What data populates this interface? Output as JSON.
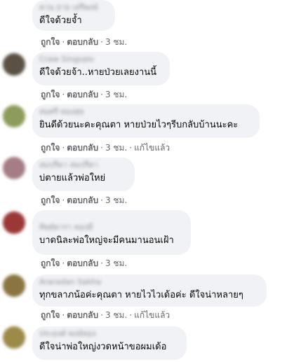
{
  "comments": [
    {
      "author": "ควน ยาย เสรีพงษ์",
      "text": "ดีใจด้วยจ้ำ",
      "like_label": "ถูกใจ",
      "reply_label": "ตอบกลับ",
      "time": "3 ชม.",
      "edited_label": "",
      "avatar_color": "#ffffff"
    },
    {
      "author": "Craw Singsalo",
      "text": "ดีใจด้วยจ้า..หายป่วยเลยงานนี้",
      "like_label": "ถูกใจ",
      "reply_label": "ตอบกลับ",
      "time": "3 ชม.",
      "edited_label": "",
      "avatar_color": "#5a5044"
    },
    {
      "author": "สมศรี ทองสุข",
      "text": "ยินดีด้วยนะคะคุณตา หายป่วยไวๆรีบกลับบ้านนะคะ",
      "like_label": "ถูกใจ",
      "reply_label": "ตอบกลับ",
      "time": "3 ชม.",
      "edited_label": "แก้ไขแล้ว",
      "avatar_color": "#8d9c5a"
    },
    {
      "author": "สมปรีดา สมปรีดา",
      "text": "บ่ตายแล้วพ่อใหย่",
      "like_label": "ถูกใจ",
      "reply_label": "ตอบกลับ",
      "time": "3 ชม.",
      "edited_label": "",
      "avatar_color": "#a47d86"
    },
    {
      "author": "ทิพย์ดารา ทองมี",
      "text": "บาดนิละพ่อใหญ่จะมีคนมานอนเฝ้า",
      "like_label": "ถูกใจ",
      "reply_label": "ตอบกลับ",
      "time": "3 ชม.",
      "edited_label": "",
      "avatar_color": "#9a3838"
    },
    {
      "author": "Araradan Sakha",
      "text": "ทุกขลาภน้อค่ะคุณตา หายไวไวเด้อค่ะ ดีใจน่าหลายๆ",
      "like_label": "ถูกใจ",
      "reply_label": "ตอบกลับ",
      "time": "3 ชม.",
      "edited_label": "แก้ไขแล้ว",
      "avatar_color": "#8a7440"
    },
    {
      "author": "ประยงค์ พงษ์ทอง",
      "text": "ดีใจน่าพ่อใหญ่งวดหน้าขอผมเด้อ",
      "like_label": "",
      "reply_label": "",
      "time": "",
      "edited_label": "",
      "avatar_color": "#9c8a48"
    }
  ]
}
